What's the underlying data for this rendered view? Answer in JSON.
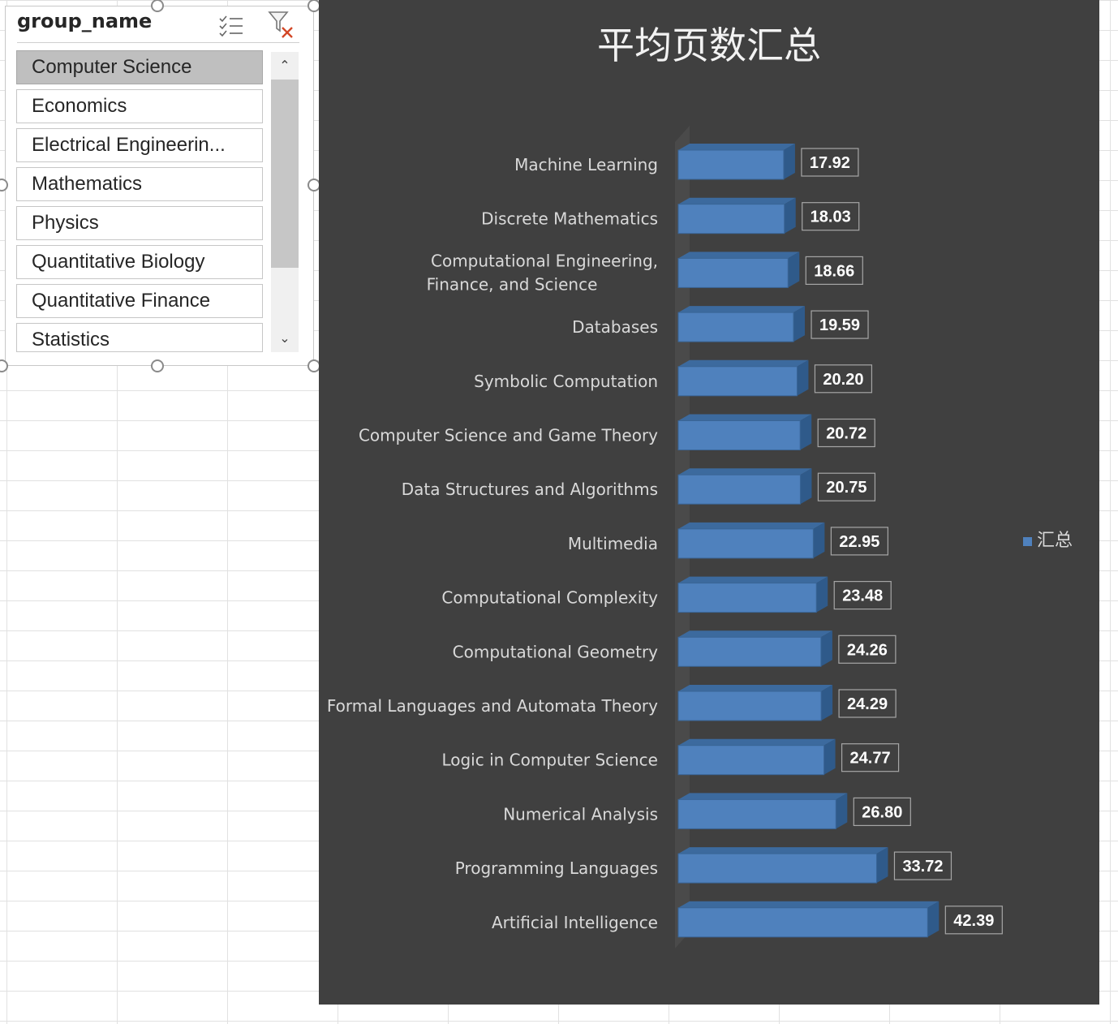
{
  "slicer": {
    "title": "group_name",
    "items": [
      {
        "label": "Computer Science",
        "selected": true
      },
      {
        "label": "Economics",
        "selected": false
      },
      {
        "label": "Electrical Engineerin...",
        "selected": false
      },
      {
        "label": "Mathematics",
        "selected": false
      },
      {
        "label": "Physics",
        "selected": false
      },
      {
        "label": "Quantitative Biology",
        "selected": false
      },
      {
        "label": "Quantitative Finance",
        "selected": false
      },
      {
        "label": "Statistics",
        "selected": false
      }
    ],
    "icons": {
      "multi_select": "multi-select-icon",
      "clear_filter": "clear-filter-icon",
      "scroll_up": "chevron-up-icon",
      "scroll_down": "chevron-down-icon"
    }
  },
  "chart_data": {
    "type": "bar",
    "orientation": "horizontal",
    "title": "平均页数汇总",
    "categories": [
      "Machine Learning",
      "Discrete Mathematics",
      "Computational Engineering, Finance, and Science",
      "Databases",
      "Symbolic Computation",
      "Computer Science and Game Theory",
      "Data Structures and Algorithms",
      "Multimedia",
      "Computational Complexity",
      "Computational Geometry",
      "Formal Languages and Automata Theory",
      "Logic in Computer Science",
      "Numerical Analysis",
      "Programming Languages",
      "Artificial Intelligence"
    ],
    "series": [
      {
        "name": "汇总",
        "values": [
          17.92,
          18.03,
          18.66,
          19.59,
          20.2,
          20.72,
          20.75,
          22.95,
          23.48,
          24.26,
          24.29,
          24.77,
          26.8,
          33.72,
          42.39
        ]
      }
    ],
    "data_labels": [
      "17.92",
      "18.03",
      "18.66",
      "19.59",
      "20.20",
      "20.72",
      "20.75",
      "22.95",
      "23.48",
      "24.26",
      "24.29",
      "24.77",
      "26.80",
      "33.72",
      "42.39"
    ],
    "xlim": [
      0,
      55
    ],
    "grid": false,
    "legend": "right",
    "colors": {
      "bar": "#4f81bd",
      "bar_top": "#3c6a9e",
      "bar_side": "#2f5a8a",
      "background": "#404040",
      "text": "#d9d9d9",
      "label_text": "#ffffff"
    }
  }
}
